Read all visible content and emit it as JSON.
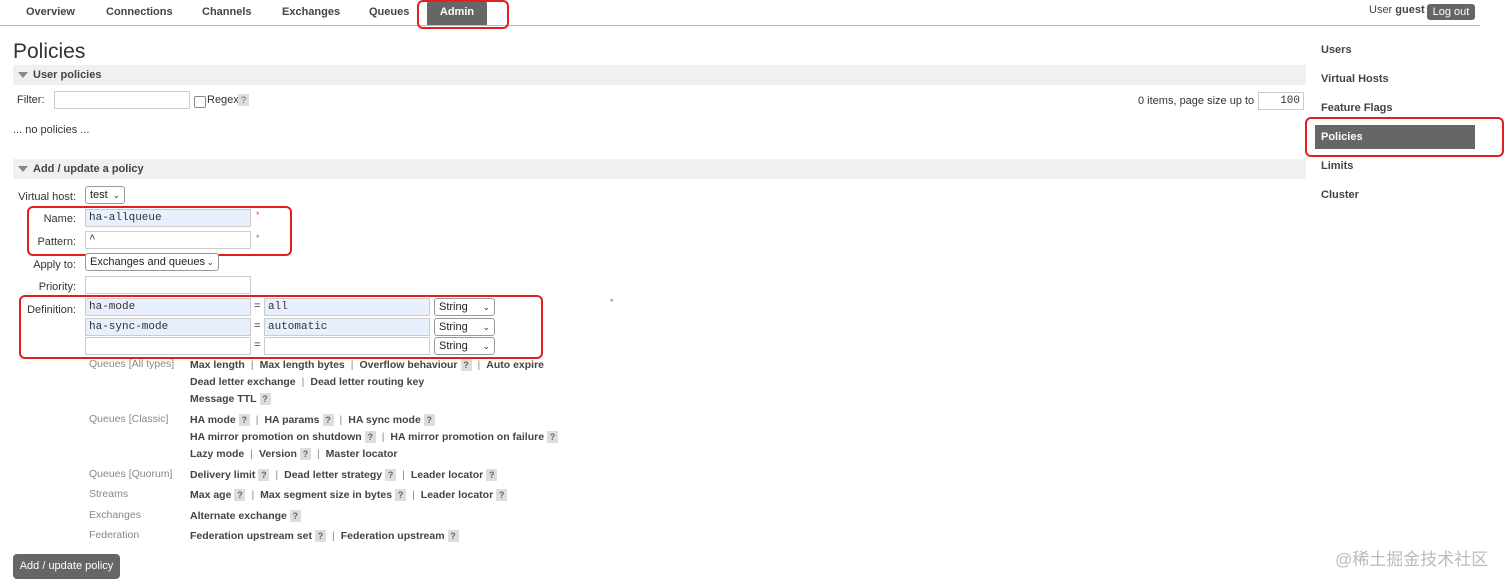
{
  "nav": {
    "tabs": [
      "Overview",
      "Connections",
      "Channels",
      "Exchanges",
      "Queues",
      "Admin"
    ],
    "active": "Admin",
    "user_label": "User",
    "user_name": "guest",
    "logout_label": "Log out"
  },
  "page": {
    "title": "Policies"
  },
  "user_policies": {
    "heading": "User policies",
    "filter_label": "Filter:",
    "filter_value": "",
    "regex_label": "Regex",
    "regex_help": "?",
    "paging_text": "0 items, page size up to",
    "page_size": "100",
    "empty_text": "... no policies ..."
  },
  "add_policy": {
    "heading": "Add / update a policy",
    "vhost_label": "Virtual host:",
    "vhost_value": "test",
    "name_label": "Name:",
    "name_value": "ha-allqueue",
    "pattern_label": "Pattern:",
    "pattern_value": "^",
    "required_mark": "*",
    "apply_label": "Apply to:",
    "apply_value": "Exchanges and queues",
    "priority_label": "Priority:",
    "priority_value": "",
    "definition_label": "Definition:",
    "equals": "=",
    "definitions": [
      {
        "key": "ha-mode",
        "value": "all",
        "type": "String"
      },
      {
        "key": "ha-sync-mode",
        "value": "automatic",
        "type": "String"
      },
      {
        "key": "",
        "value": "",
        "type": "String"
      }
    ],
    "submit_label": "Add / update policy"
  },
  "hints": {
    "queues_all_label": "Queues [All types]",
    "queues_all_line1": [
      "Max length",
      "Max length bytes",
      "Overflow behaviour",
      "Auto expire"
    ],
    "queues_all_line2": [
      "Dead letter exchange",
      "Dead letter routing key"
    ],
    "queues_all_line3": [
      "Message TTL"
    ],
    "queues_classic_label": "Queues [Classic]",
    "queues_classic_line1": [
      "HA mode",
      "HA params",
      "HA sync mode"
    ],
    "queues_classic_line2": [
      "HA mirror promotion on shutdown",
      "HA mirror promotion on failure"
    ],
    "queues_classic_line3": [
      "Lazy mode",
      "Version",
      "Master locator"
    ],
    "queues_quorum_label": "Queues [Quorum]",
    "queues_quorum_line1": [
      "Delivery limit",
      "Dead letter strategy",
      "Leader locator"
    ],
    "streams_label": "Streams",
    "streams_line1": [
      "Max age",
      "Max segment size in bytes",
      "Leader locator"
    ],
    "exchanges_label": "Exchanges",
    "exchanges_line1": [
      "Alternate exchange"
    ],
    "federation_label": "Federation",
    "federation_line1": [
      "Federation upstream set",
      "Federation upstream"
    ],
    "help": "?",
    "sep": "|"
  },
  "sidebar": {
    "items": [
      "Users",
      "Virtual Hosts",
      "Feature Flags",
      "Policies",
      "Limits",
      "Cluster"
    ],
    "active": "Policies"
  },
  "watermark": "@稀土掘金技术社区",
  "colors": {
    "accent": "#666666",
    "highlight": "#e02020",
    "required": "#ee4444"
  }
}
